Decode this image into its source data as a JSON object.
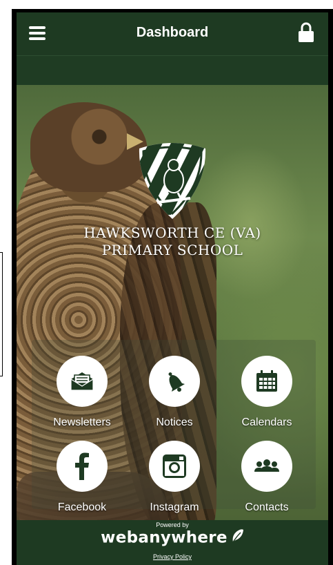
{
  "header": {
    "title": "Dashboard",
    "menu_icon": "hamburger-menu-icon",
    "lock_icon": "lock-icon"
  },
  "school": {
    "name_line1": "HAWKSWORTH CE (VA)",
    "name_line2": "PRIMARY SCHOOL"
  },
  "tiles": [
    {
      "label": "Newsletters",
      "icon": "envelope-icon"
    },
    {
      "label": "Notices",
      "icon": "bell-icon"
    },
    {
      "label": "Calendars",
      "icon": "calendar-icon"
    },
    {
      "label": "Facebook",
      "icon": "facebook-icon"
    },
    {
      "label": "Instagram",
      "icon": "instagram-icon"
    },
    {
      "label": "Contacts",
      "icon": "people-icon"
    }
  ],
  "footer": {
    "powered_by": "Powered by",
    "brand": "webanywhere",
    "privacy": "Privacy Policy"
  },
  "colors": {
    "header_bg": "#1e3a22",
    "icon_green": "#1e3a22",
    "tile_circle": "#ffffff"
  }
}
